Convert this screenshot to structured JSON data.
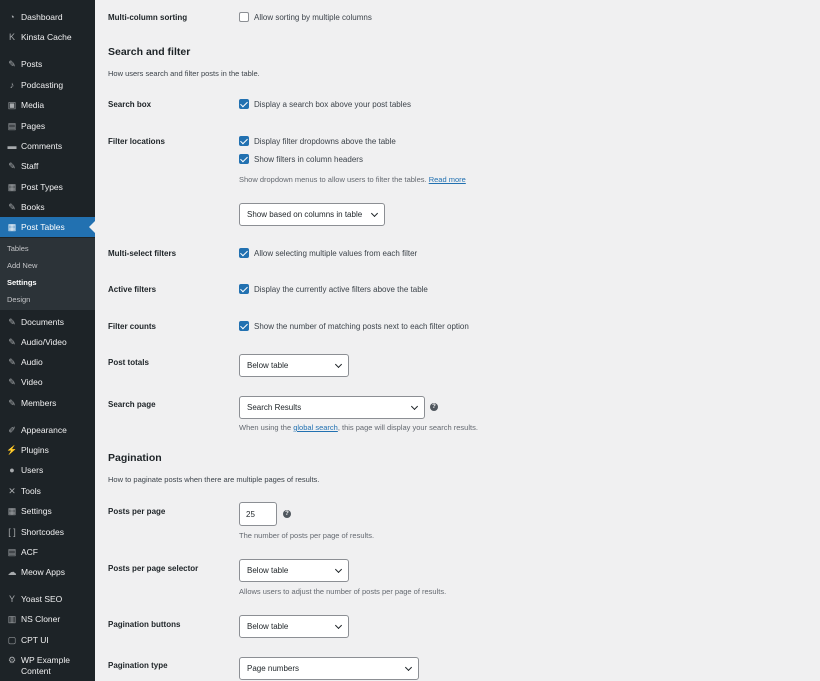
{
  "sidebar": {
    "items": [
      {
        "label": "Dashboard",
        "icon": "dashboard-icon",
        "glyph": "◔"
      },
      {
        "label": "Kinsta Cache",
        "icon": "kinsta-icon",
        "glyph": "K"
      },
      {
        "label": "Posts",
        "icon": "pin-icon",
        "glyph": "✎"
      },
      {
        "label": "Podcasting",
        "icon": "microphone-icon",
        "glyph": "♪"
      },
      {
        "label": "Media",
        "icon": "media-icon",
        "glyph": "▣"
      },
      {
        "label": "Pages",
        "icon": "pages-icon",
        "glyph": "▤"
      },
      {
        "label": "Comments",
        "icon": "comments-icon",
        "glyph": "▬"
      },
      {
        "label": "Staff",
        "icon": "pin-icon",
        "glyph": "✎"
      },
      {
        "label": "Post Types",
        "icon": "post-types-icon",
        "glyph": "▦"
      },
      {
        "label": "Books",
        "icon": "pin-icon",
        "glyph": "✎"
      },
      {
        "label": "Post Tables",
        "icon": "table-icon",
        "glyph": "▦"
      },
      {
        "label": "Documents",
        "icon": "pin-icon",
        "glyph": "✎"
      },
      {
        "label": "Audio/Video",
        "icon": "pin-icon",
        "glyph": "✎"
      },
      {
        "label": "Audio",
        "icon": "pin-icon",
        "glyph": "✎"
      },
      {
        "label": "Video",
        "icon": "pin-icon",
        "glyph": "✎"
      },
      {
        "label": "Members",
        "icon": "pin-icon",
        "glyph": "✎"
      },
      {
        "label": "Appearance",
        "icon": "brush-icon",
        "glyph": "✐"
      },
      {
        "label": "Plugins",
        "icon": "plug-icon",
        "glyph": "⚡"
      },
      {
        "label": "Users",
        "icon": "user-icon",
        "glyph": "●"
      },
      {
        "label": "Tools",
        "icon": "wrench-icon",
        "glyph": "✕"
      },
      {
        "label": "Settings",
        "icon": "settings-icon",
        "glyph": "▦"
      },
      {
        "label": "Shortcodes",
        "icon": "brackets-icon",
        "glyph": "[ ]"
      },
      {
        "label": "ACF",
        "icon": "acf-icon",
        "glyph": "▤"
      },
      {
        "label": "Meow Apps",
        "icon": "meow-icon",
        "glyph": "☁"
      },
      {
        "label": "Yoast SEO",
        "icon": "yoast-icon",
        "glyph": "Y"
      },
      {
        "label": "NS Cloner",
        "icon": "cloner-icon",
        "glyph": "▥"
      },
      {
        "label": "CPT UI",
        "icon": "cpt-icon",
        "glyph": "▢"
      },
      {
        "label": "WP Example Content",
        "icon": "gear-icon",
        "glyph": "⚙"
      }
    ],
    "submenu": [
      "Tables",
      "Add New",
      "Settings",
      "Design"
    ]
  },
  "main": {
    "multi_sort_label": "Multi-column sorting",
    "multi_sort_cb": "Allow sorting by multiple columns",
    "search_section_title": "Search and filter",
    "search_section_desc": "How users search and filter posts in the table.",
    "search_box_label": "Search box",
    "search_box_cb": "Display a search box above your post tables",
    "filter_locations_label": "Filter locations",
    "filter_dropdowns_cb": "Display filter dropdowns above the table",
    "filter_headers_cb": "Show filters in column headers",
    "filter_help": "Show dropdown menus to allow users to filter the tables.",
    "filter_help_link": "Read more",
    "filter_select": "Show based on columns in table",
    "multiselect_label": "Multi-select filters",
    "multiselect_cb": "Allow selecting multiple values from each filter",
    "active_filters_label": "Active filters",
    "active_filters_cb": "Display the currently active filters above the table",
    "filter_counts_label": "Filter counts",
    "filter_counts_cb": "Show the number of matching posts next to each filter option",
    "post_totals_label": "Post totals",
    "post_totals_select": "Below table",
    "search_page_label": "Search page",
    "search_page_select": "Search Results",
    "search_page_help_pre": "When using the",
    "search_page_help_link": "global search",
    "search_page_help_post": ", this page will display your search results.",
    "pagination_title": "Pagination",
    "pagination_desc": "How to paginate posts when there are multiple pages of results.",
    "per_page_label": "Posts per page",
    "per_page_value": "25",
    "per_page_help": "The number of posts per page of results.",
    "per_page_selector_label": "Posts per page selector",
    "per_page_selector_select": "Below table",
    "per_page_selector_help": "Allows users to adjust the number of posts per page of results.",
    "pagination_buttons_label": "Pagination buttons",
    "pagination_buttons_select": "Below table",
    "pagination_type_label": "Pagination type",
    "pagination_type_select": "Page numbers",
    "help_glyph": "?"
  },
  "colors": {
    "sidebar_bg": "#1d2327",
    "accent": "#2271b1",
    "page_bg": "#f0f0f1"
  }
}
